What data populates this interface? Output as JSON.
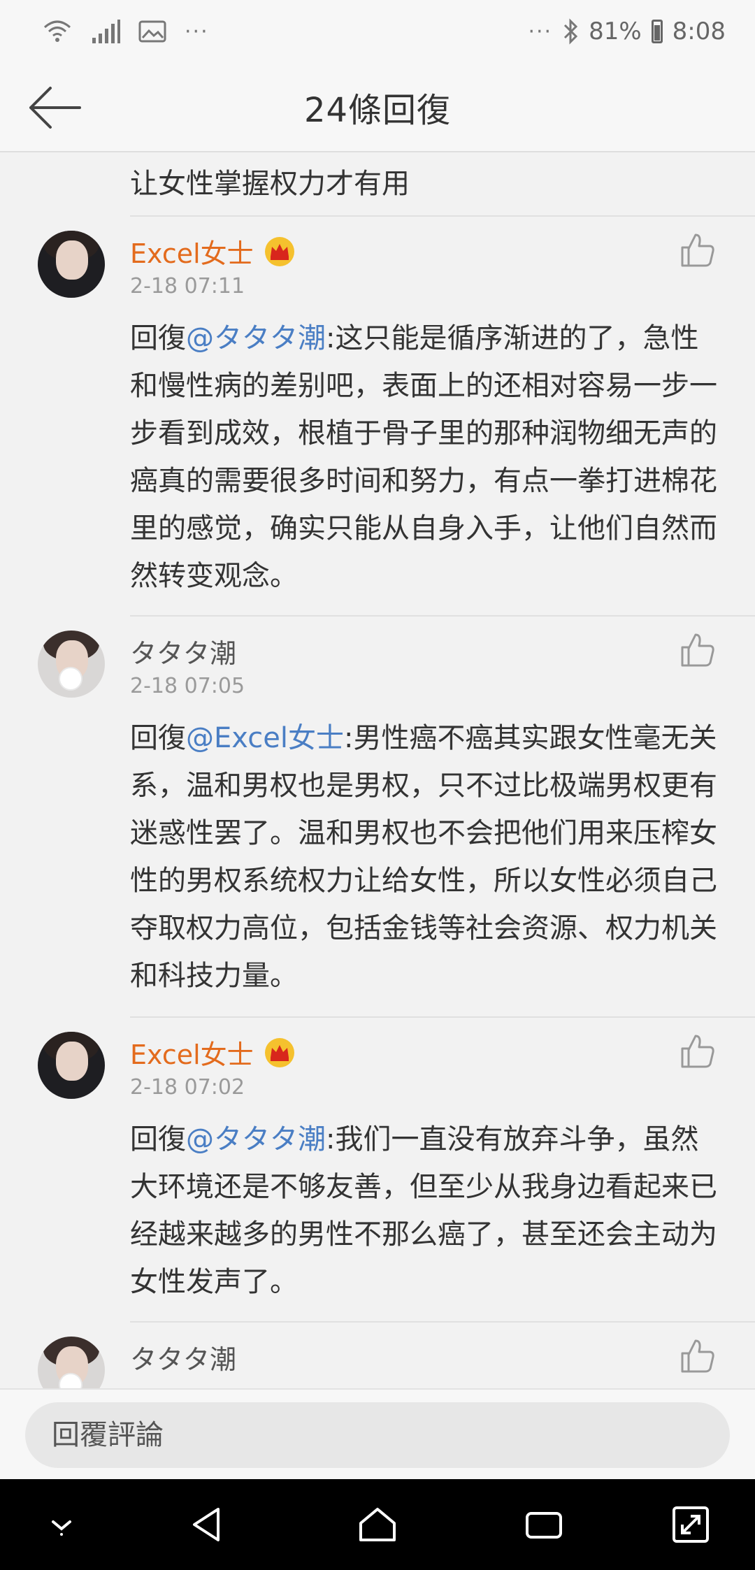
{
  "status_bar": {
    "dots_left": "···",
    "dots_right": "···",
    "battery": "81%",
    "time": "8:08"
  },
  "header": {
    "title": "24條回復"
  },
  "previous_comment_tail": "让女性掌握权力才有用",
  "comments": [
    {
      "name": "Excel女士",
      "vip": true,
      "time": "2-18 07:11",
      "reply_prefix": "回復",
      "mention": "@タタタ潮",
      "text": ":这只能是循序渐进的了，急性和慢性病的差别吧，表面上的还相对容易一步一步看到成效，根植于骨子里的那种润物细无声的癌真的需要很多时间和努力，有点一拳打进棉花里的感觉，确实只能从自身入手，让他们自然而然转变观念。"
    },
    {
      "name": "タタタ潮",
      "vip": false,
      "time": "2-18 07:05",
      "reply_prefix": "回復",
      "mention": "@Excel女士",
      "text": ":男性癌不癌其实跟女性毫无关系，温和男权也是男权，只不过比极端男权更有迷惑性罢了。温和男权也不会把他们用来压榨女性的男权系统权力让给女性，所以女性必须自己夺取权力高位，包括金钱等社会资源、权力机关和科技力量。"
    },
    {
      "name": "Excel女士",
      "vip": true,
      "time": "2-18 07:02",
      "reply_prefix": "回復",
      "mention": "@タタタ潮",
      "text": ":我们一直没有放弃斗争，虽然大环境还是不够友善，但至少从我身边看起来已经越来越多的男性不那么癌了，甚至还会主动为女性发声了。"
    },
    {
      "name": "タタタ潮",
      "vip": false
    }
  ],
  "input": {
    "placeholder": "回覆評論"
  },
  "colors": {
    "vip_name": "#e36b1d",
    "mention": "#4a7ec4",
    "background": "#f2f2f2"
  },
  "icons": [
    "wifi-icon",
    "signal-icon",
    "image-icon",
    "bluetooth-icon",
    "battery-icon",
    "back-arrow-icon",
    "crown-icon",
    "thumbs-up-icon",
    "nav-down-icon",
    "nav-back-icon",
    "nav-home-icon",
    "nav-recents-icon",
    "nav-expand-icon"
  ]
}
